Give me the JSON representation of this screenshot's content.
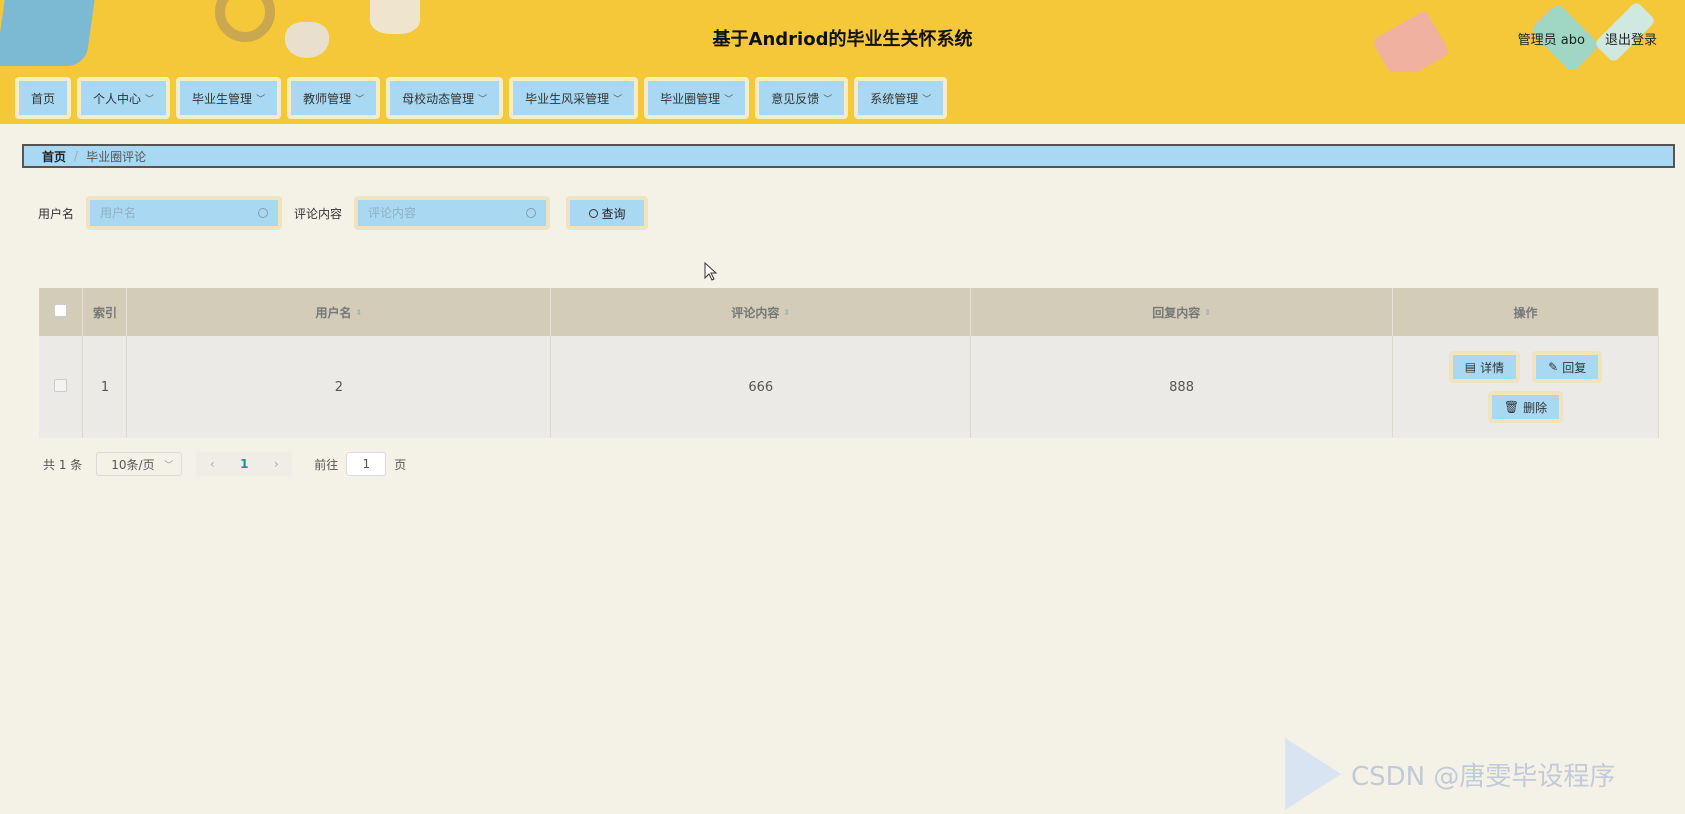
{
  "app": {
    "title": "基于Andriod的毕业生关怀系统",
    "user": "管理员 abo",
    "logout": "退出登录"
  },
  "nav": [
    {
      "label": "首页",
      "dropdown": false
    },
    {
      "label": "个人中心",
      "dropdown": true
    },
    {
      "label": "毕业生管理",
      "dropdown": true
    },
    {
      "label": "教师管理",
      "dropdown": true
    },
    {
      "label": "母校动态管理",
      "dropdown": true
    },
    {
      "label": "毕业生风采管理",
      "dropdown": true
    },
    {
      "label": "毕业圈管理",
      "dropdown": true
    },
    {
      "label": "意见反馈",
      "dropdown": true
    },
    {
      "label": "系统管理",
      "dropdown": true
    }
  ],
  "breadcrumb": {
    "home": "首页",
    "current": "毕业圈评论"
  },
  "search": {
    "username_label": "用户名",
    "username_placeholder": "用户名",
    "comment_label": "评论内容",
    "comment_placeholder": "评论内容",
    "query_label": "查询"
  },
  "table": {
    "headers": {
      "index": "索引",
      "username": "用户名",
      "comment": "评论内容",
      "reply": "回复内容",
      "actions": "操作"
    },
    "rows": [
      {
        "index": "1",
        "username": "2",
        "comment": "666",
        "reply": "888"
      }
    ],
    "actions": {
      "detail": "详情",
      "reply": "回复",
      "delete": "删除"
    }
  },
  "pagination": {
    "total": "共 1 条",
    "page_size": "10条/页",
    "current_page": "1",
    "goto_label": "前往",
    "goto_value": "1",
    "page_suffix": "页"
  },
  "watermark": {
    "text": "CSDN @唐雯毕设程序"
  },
  "colors": {
    "header_bg": "#f5c83a",
    "button_bg": "#a9d8f2",
    "page_bg": "#f4f1e6"
  }
}
